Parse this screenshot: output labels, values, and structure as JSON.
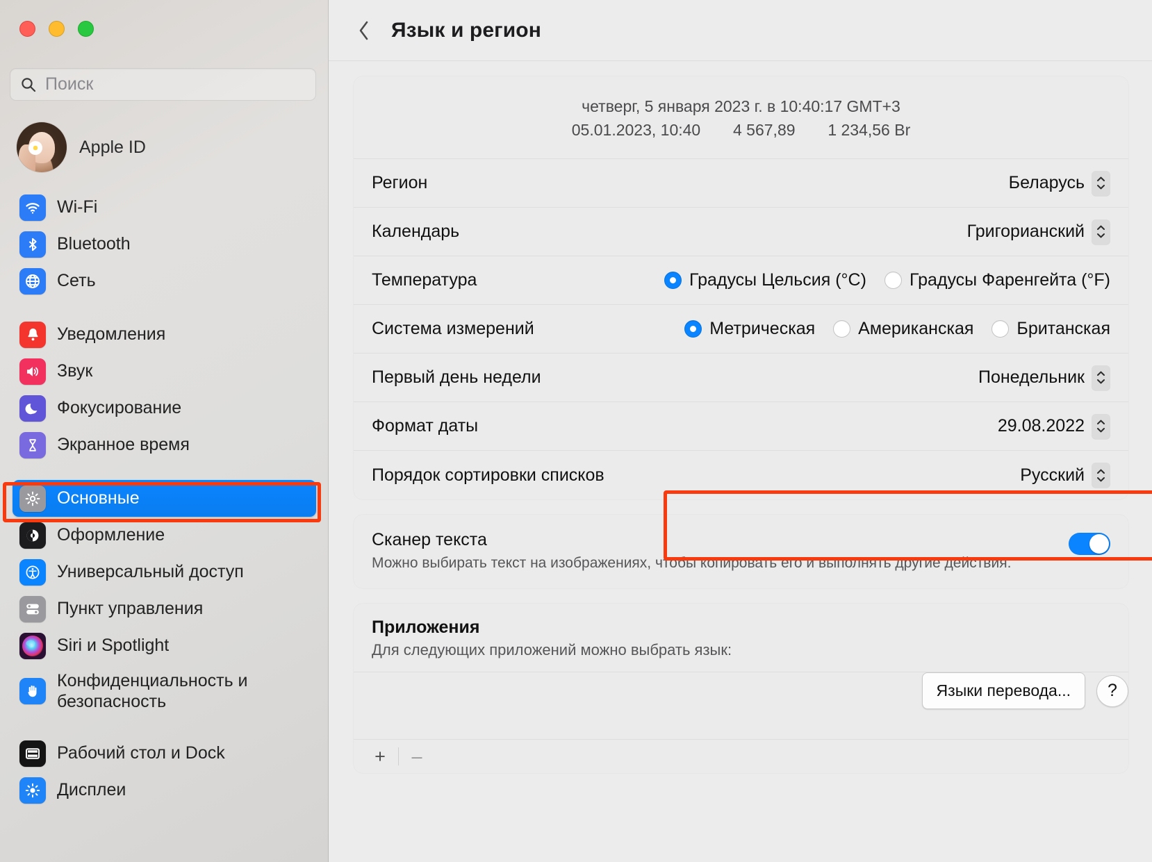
{
  "window": {
    "traffic_lights": [
      "close",
      "minimize",
      "zoom"
    ],
    "accent_color": "#0a84ff",
    "highlight_color": "#f93a0e"
  },
  "sidebar": {
    "search": {
      "placeholder": "Поиск",
      "value": ""
    },
    "account": {
      "label": "Apple ID"
    },
    "groups": [
      {
        "items": [
          {
            "label": "Wi-Fi",
            "icon": "wifi-icon",
            "color": "#2b7cf6",
            "selected": false
          },
          {
            "label": "Bluetooth",
            "icon": "bluetooth-icon",
            "color": "#2b7cf6",
            "selected": false
          },
          {
            "label": "Сеть",
            "icon": "globe-icon",
            "color": "#2b7cf6",
            "selected": false
          }
        ]
      },
      {
        "items": [
          {
            "label": "Уведомления",
            "icon": "bell-icon",
            "color": "#f4352e",
            "selected": false
          },
          {
            "label": "Звук",
            "icon": "speaker-icon",
            "color": "#f2315f",
            "selected": false
          },
          {
            "label": "Фокусирование",
            "icon": "moon-icon",
            "color": "#6055d8",
            "selected": false
          },
          {
            "label": "Экранное время",
            "icon": "hourglass-icon",
            "color": "#7a6ae0",
            "selected": false
          }
        ]
      },
      {
        "items": [
          {
            "label": "Основные",
            "icon": "gear-icon",
            "color": "#9a9a9e",
            "selected": true
          },
          {
            "label": "Оформление",
            "icon": "appearance-icon",
            "color": "#1c1c1e",
            "selected": false
          },
          {
            "label": "Универсальный доступ",
            "icon": "accessibility-icon",
            "color": "#0a84ff",
            "selected": false
          },
          {
            "label": "Пункт управления",
            "icon": "control-center-icon",
            "color": "#9a9a9e",
            "selected": false
          },
          {
            "label": "Siri и Spotlight",
            "icon": "siri-icon",
            "color": "#3b1d4e",
            "selected": false
          },
          {
            "label": "Конфиденциальность и безопасность",
            "icon": "hand-icon",
            "color": "#1f84f7",
            "selected": false
          }
        ]
      },
      {
        "items": [
          {
            "label": "Рабочий стол и Dock",
            "icon": "desktop-dock-icon",
            "color": "#141414",
            "selected": false
          },
          {
            "label": "Дисплеи",
            "icon": "brightness-icon",
            "color": "#1f84f7",
            "selected": false
          }
        ]
      }
    ]
  },
  "header": {
    "back_icon": "chevron-left-icon",
    "title": "Язык и регион"
  },
  "preview": {
    "line1": "четверг, 5 января 2023 г. в 10:40:17 GMT+3",
    "line2_date": "05.01.2023, 10:40",
    "line2_number": "4 567,89",
    "line2_currency": "1 234,56 Br"
  },
  "settings_rows": [
    {
      "label": "Регион",
      "value": "Беларусь",
      "control": "popup"
    },
    {
      "label": "Календарь",
      "value": "Григорианский",
      "control": "popup"
    },
    {
      "label": "Первый день недели",
      "value": "Понедельник",
      "control": "popup"
    },
    {
      "label": "Формат даты",
      "value": "29.08.2022",
      "control": "popup"
    },
    {
      "label": "Порядок сортировки списков",
      "value": "Русский",
      "control": "popup"
    }
  ],
  "temperature": {
    "label": "Температура",
    "options": [
      {
        "label": "Градусы Цельсия (°C)",
        "selected": true
      },
      {
        "label": "Градусы Фаренгейта (°F)",
        "selected": false
      }
    ]
  },
  "measurement": {
    "label": "Система измерений",
    "options": [
      {
        "label": "Метрическая",
        "selected": true
      },
      {
        "label": "Американская",
        "selected": false
      },
      {
        "label": "Британская",
        "selected": false
      }
    ]
  },
  "text_scanner": {
    "title": "Сканер текста",
    "description": "Можно выбирать текст на изображениях, чтобы копировать его и выполнять другие действия.",
    "enabled": true
  },
  "applications": {
    "title": "Приложения",
    "subtitle": "Для следующих приложений можно выбрать язык:",
    "items": [],
    "add_label": "+",
    "remove_label": "–"
  },
  "footer": {
    "translate_button": "Языки перевода...",
    "help_button": "?"
  }
}
